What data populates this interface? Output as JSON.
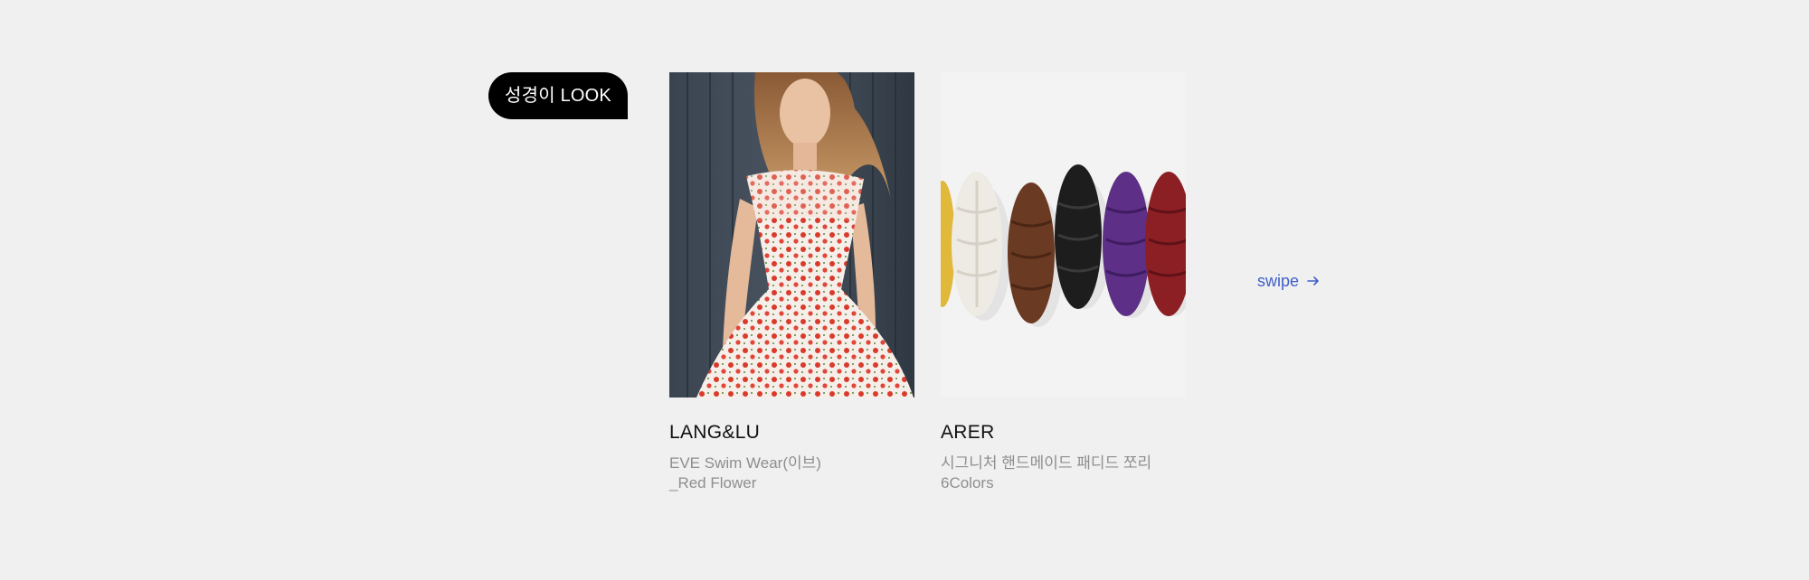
{
  "section": {
    "tag_label": "성경이 LOOK",
    "swipe_label": "swipe",
    "swipe_icon": "arrow-right-icon",
    "accent_color": "#3f5fc9"
  },
  "products": [
    {
      "brand": "LANG&LU",
      "desc_line1": "EVE Swim Wear(이브)",
      "desc_line2": "_Red Flower",
      "image": "woman in red floral dress against dark wood wall"
    },
    {
      "brand": "ARER",
      "desc_line1": "시그니처 핸드메이드 패디드 쪼리",
      "desc_line2": "6Colors",
      "image": "row of woven leather sandals in six colors"
    }
  ]
}
